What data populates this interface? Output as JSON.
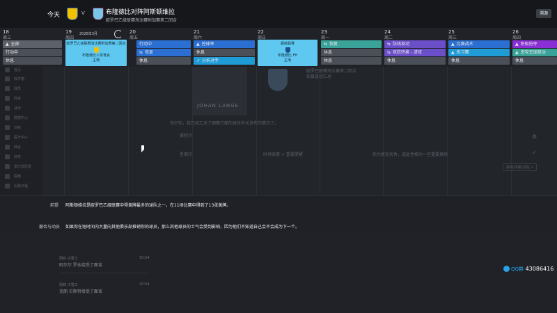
{
  "header": {
    "today_label": "今天",
    "vs": "V",
    "match_title": "布隆德比对阵阿斯顿维拉",
    "match_subtitle": "欧罗巴乙级联赛淘汰赛附加赛第二回合",
    "close_label": "溯源"
  },
  "calendar": {
    "month_label": "2026年3月",
    "days": [
      {
        "num": "18",
        "weekday": "周三",
        "slots": [
          {
            "type": "gray",
            "icon": "▲",
            "label": "全部"
          },
          {
            "type": "rest",
            "icon": "",
            "label": "行动中"
          },
          {
            "type": "rest",
            "icon": "",
            "label": "休息"
          }
        ]
      },
      {
        "num": "19",
        "weekday": "周四",
        "match": {
          "line1": "欧罗巴乙级联赛淘汰赛附加赛第二回合",
          "line2": "布隆德比人体育会",
          "line3": "主场"
        },
        "slots": []
      },
      {
        "num": "20",
        "weekday": "周五",
        "slots": [
          {
            "type": "blue",
            "icon": "",
            "label": "行动中"
          },
          {
            "type": "blue",
            "icon": "⇆",
            "label": "恢复"
          },
          {
            "type": "rest",
            "icon": "",
            "label": "休息"
          }
        ]
      },
      {
        "num": "21",
        "weekday": "周六",
        "slots": [
          {
            "type": "blue",
            "icon": "▲",
            "label": "控球率"
          },
          {
            "type": "rest",
            "icon": "",
            "label": "休息"
          },
          {
            "type": "cyan",
            "icon": "↗",
            "label": "分析对手"
          }
        ]
      },
      {
        "num": "22",
        "weekday": "周日",
        "match": {
          "line1": "超级联赛",
          "line2": "布隆德比 FH",
          "line3": "主场"
        },
        "slots": []
      },
      {
        "num": "23",
        "weekday": "周一",
        "slots": [
          {
            "type": "teal",
            "icon": "⇆",
            "label": "恢复"
          },
          {
            "type": "rest",
            "icon": "",
            "label": "休息"
          },
          {
            "type": "rest",
            "icon": "",
            "label": "休息"
          }
        ]
      },
      {
        "num": "24",
        "weekday": "周二",
        "slots": [
          {
            "type": "purple",
            "icon": "⇆",
            "label": "防线发动"
          },
          {
            "type": "purple",
            "icon": "⇆",
            "label": "攻防转换 - 进攻"
          },
          {
            "type": "rest",
            "icon": "",
            "label": "休息"
          }
        ]
      },
      {
        "num": "25",
        "weekday": "周三",
        "slots": [
          {
            "type": "blue",
            "icon": "▲",
            "label": "比赛战术"
          },
          {
            "type": "cyan",
            "icon": "▲",
            "label": "练习赛"
          },
          {
            "type": "rest",
            "icon": "",
            "label": "休息"
          }
        ]
      },
      {
        "num": "26",
        "weekday": "周四",
        "slots": [
          {
            "type": "violet",
            "icon": "▲",
            "label": "积极抢夺"
          },
          {
            "type": "teal",
            "icon": "▲",
            "label": "进攻无球跑动"
          },
          {
            "type": "rest",
            "icon": "",
            "label": "休息"
          }
        ]
      }
    ]
  },
  "background": {
    "player_name": "JOHAN LANGE",
    "line_a": "欧罗巴联赛淘汰赛第二回合",
    "line_b": "招募普冠汇总",
    "intro": "你好你，我已经汇总了随赛方面的球员有关发布的情况了。",
    "col1": "赛程冷",
    "col2": "赛程冷动",
    "col3": "赛程冷后",
    "row1a": "星期冷",
    "row1b": "时有联赛 > 重要提醒",
    "row1c": "能力更加优秀，或此性格为一些重要接续",
    "button": "接待/排期/议程 >"
  },
  "nav": {
    "items": [
      "首页",
      "收件箱",
      "球员",
      "阵容",
      "战术",
      "数据中心",
      "训练",
      "医疗中心",
      "转会",
      "财务",
      "俱乐部愿景",
      "联赛",
      "比赛日程",
      "新闻"
    ]
  },
  "info": {
    "row1_label": "前提",
    "row1_text": "阿斯顿维拉是欧罗巴乙级联赛中得黄牌最多的球队之一，在11场比赛中得到了13张黄牌。",
    "row2_label": "撤否与动员",
    "row2_text": "如果你在短时间内大量向其他俱乐部推销你的球员，那么其他球员的士气会受到影响，因为他们不知道自己会不会成为下一个。"
  },
  "messages": [
    {
      "meta": "周四 冷雪工",
      "text": "阿尔尔 罗本接受了面谈",
      "time": "10:54"
    },
    {
      "meta": "周四 冷雪工",
      "text": "克朗 贝斯特接受了面谈",
      "time": "10:54"
    }
  ],
  "watermark": {
    "label": "QQ群",
    "number": "43086416"
  }
}
